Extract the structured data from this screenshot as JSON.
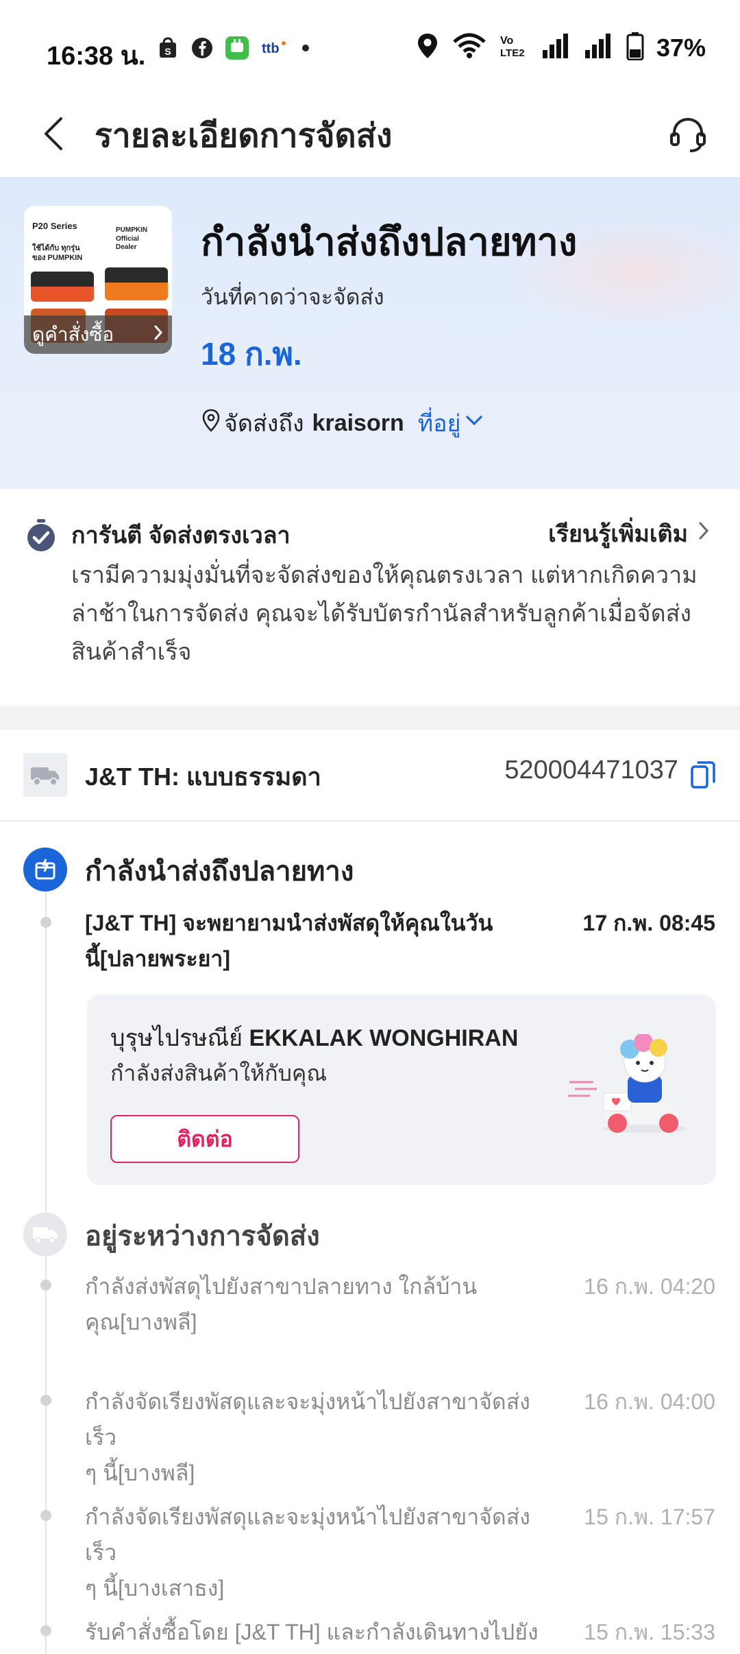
{
  "status_bar": {
    "time": "16:38 น.",
    "battery_percent": "37%",
    "icons": [
      "shopee-bag-icon",
      "facebook-icon",
      "line-app-icon",
      "ttb-icon",
      "dot-icon",
      "location-icon",
      "wifi-icon",
      "volte-icon",
      "signal-icon",
      "signal-icon",
      "battery-icon"
    ]
  },
  "header": {
    "title": "รายละเอียดการจัดส่ง",
    "back_icon": "chevron-left-icon",
    "support_icon": "headset-icon"
  },
  "hero": {
    "product_image": {
      "series": "P20 Series",
      "subtitle_line1": "ใช้ได้กับ ทุกรุ่น",
      "subtitle_line2": "ของ PUMPKIN",
      "brand_line1": "PUMPKIN",
      "brand_line2": "Official",
      "brand_line3": "Dealer"
    },
    "view_order_label": "ดูคำสั่งซื้อ",
    "status_title": "กำลังนำส่งถึงปลายทาง",
    "eta_label": "วันที่คาดว่าจะจัดส่ง",
    "eta_date": "18 ก.พ.",
    "ship_to_label": "จัดส่งถึง",
    "recipient": "kraisorn",
    "address_link": "ที่อยู่"
  },
  "guarantee": {
    "title": "การันตี จัดส่งตรงเวลา",
    "learn_more": "เรียนรู้เพิ่มเติม",
    "body_line1": "เรามีความมุ่งมั่นที่จะจัดส่งของให้คุณตรงเวลา แต่หากเกิดความ",
    "body_line2": "ล่าช้าในการจัดส่ง คุณจะได้รับบัตรกำนัลสำหรับลูกค้าเมื่อจัดส่ง",
    "body_line3": "สินค้าสำเร็จ"
  },
  "courier": {
    "name": "J&T TH: แบบธรรมดา",
    "tracking_number": "520004471037"
  },
  "timeline": {
    "stage_active": {
      "title": "กำลังนำส่งถึงปลายทาง",
      "event_line1": "[J&T TH] จะพยายามนำส่งพัสดุให้คุณในวัน",
      "event_line2": "นี้[ปลายพระยา]",
      "event_time": "17 ก.พ. 08:45",
      "courier_prefix": "บุรุษไปรษณีย์",
      "courier_name": "EKKALAK WONGHIRAN",
      "courier_status": "กำลังส่งสินค้าให้กับคุณ",
      "contact_label": "ติดต่อ"
    },
    "stage_transit": {
      "title": "อยู่ระหว่างการจัดส่ง",
      "events": [
        {
          "line1": "กำลังส่งพัสดุไปยังสาขาปลายทาง ใกล้บ้าน",
          "line2": "คุณ[บางพลี]",
          "time": "16 ก.พ. 04:20"
        },
        {
          "line1": "กำลังจัดเรียงพัสดุและจะมุ่งหน้าไปยังสาขาจัดส่ง เร็ว",
          "line2": "ๆ นี้[บางพลี]",
          "time": "16 ก.พ. 04:00"
        },
        {
          "line1": "กำลังจัดเรียงพัสดุและจะมุ่งหน้าไปยังสาขาจัดส่ง เร็ว",
          "line2": "ๆ นี้[บางเสาธง]",
          "time": "15 ก.พ. 17:57"
        },
        {
          "line1": "รับคำสั่งซื้อโดย [J&T TH] และกำลังเดินทางไปยัง",
          "line2": "",
          "time": "15 ก.พ. 15:33"
        }
      ]
    }
  },
  "colors": {
    "accent_blue": "#1a66d9",
    "contact_pink": "#e0245e",
    "hero_bg": "#dde9fb"
  }
}
